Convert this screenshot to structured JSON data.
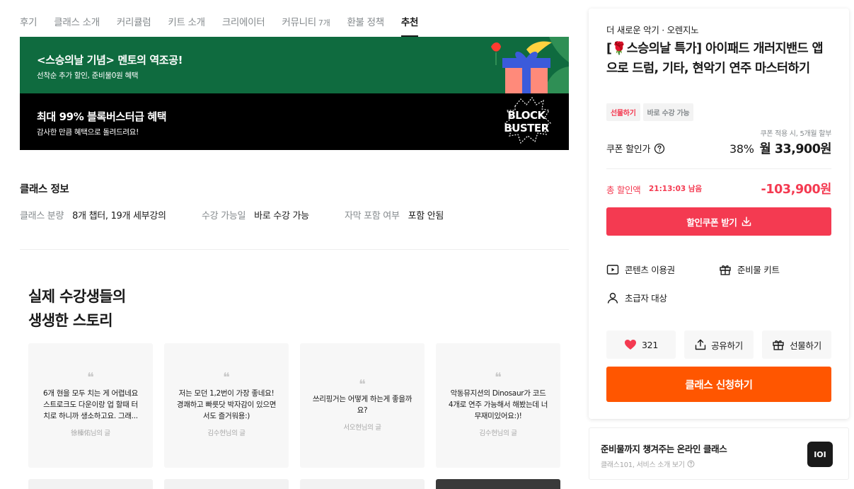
{
  "tabs": [
    {
      "label": "후기",
      "count": ""
    },
    {
      "label": "클래스 소개",
      "count": ""
    },
    {
      "label": "커리큘럼",
      "count": ""
    },
    {
      "label": "키트 소개",
      "count": ""
    },
    {
      "label": "크리에이터",
      "count": ""
    },
    {
      "label": "커뮤니티",
      "count": "7개"
    },
    {
      "label": "환불 정책",
      "count": ""
    },
    {
      "label": "추천",
      "count": ""
    }
  ],
  "active_tab": "추천",
  "banners": [
    {
      "title": "<스승의날 기념> 멘토의 역조공!",
      "subtitle": "선착순 추가 할인, 준비물0원 혜택",
      "bg": "#0f6b3f"
    },
    {
      "title": "최대 99% 블록버스터급 혜택",
      "subtitle": "감사한 만큼 혜택으로 돌려드려요!",
      "bg": "#000000",
      "art_text": [
        "BLOCK",
        "BUSTER"
      ]
    }
  ],
  "class_info": {
    "title": "클래스 정보",
    "items": [
      {
        "key": "클래스 분량",
        "value": "8개 챕터, 19개 세부강의"
      },
      {
        "key": "수강 가능일",
        "value": "바로 수강 가능"
      },
      {
        "key": "자막 포함 여부",
        "value": "포함 안됨"
      }
    ]
  },
  "stories": {
    "title_line1": "실제 수강생들의",
    "title_line2": "생생한 스토리",
    "quote_mark": "❝",
    "cards": [
      {
        "lines": [
          "6개 현을 모두 치는 게 어렵네요",
          "스트로크도 다운이랑 업 할때 터",
          "치로 하니까 생소하고요. 그래..."
        ],
        "author": "徐榛佑님의 글"
      },
      {
        "lines": [
          "저는 모던 1,2번이 가장 좋네요!",
          "경쾌하고 빠릇닷 박자감이 있으면",
          "서도 즐거워용:)"
        ],
        "author": "김수현님의 글"
      },
      {
        "lines": [
          "쓰리핑거는 어떻게 하는게 좋을까",
          "요?"
        ],
        "author": "서오현님의 글"
      },
      {
        "lines": [
          "악동뮤지션의 Dinosaur가 코드",
          "4개로 연주 가능해서 해봤는데 너",
          "무재미있어요:)!"
        ],
        "author": "김수현님의 글"
      }
    ]
  },
  "panel": {
    "brand": "더 새로운 악기 · 오렌지노",
    "title": "[🌹스승의날 특가] 아이패드 개러지밴드 앱으로 드럼, 기타, 현악기 연주 마스터하기",
    "badges": [
      "선물하기",
      "바로 수강 가능"
    ],
    "coupon_note": "쿠폰 적용 시, 5개월 할부",
    "coupon_label": "쿠폰 할인가",
    "discount_pct": "38%",
    "price": "월 33,900원",
    "total_discount_label": "총 할인액",
    "timer": "21:13:03 남음",
    "total_discount": "-103,900원",
    "coupon_button": "할인쿠폰 받기",
    "features": [
      "콘텐츠 이용권",
      "준비물 키트",
      "초급자 대상"
    ],
    "like_count": "321",
    "share_label": "공유하기",
    "gift_label": "선물하기",
    "apply_button": "클래스 신청하기"
  },
  "promo": {
    "title": "준비물까지 챙겨주는 온라인 클래스",
    "subtitle": "클래스101, 서비스 소개 보기",
    "logo": "IOI"
  },
  "colors": {
    "accent_red": "#f43a51",
    "accent_orange": "#ff5600",
    "banner_green": "#0f6b3f"
  }
}
